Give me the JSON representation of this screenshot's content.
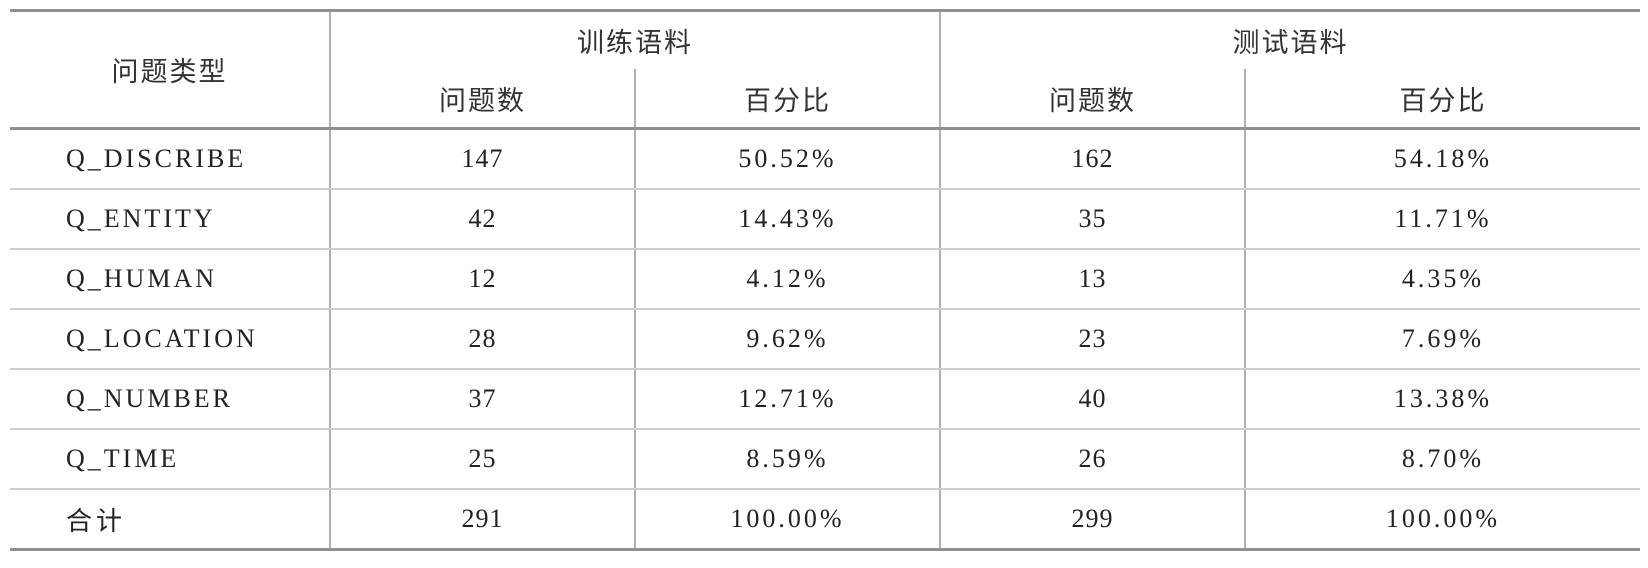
{
  "table": {
    "type_header": "问题类型",
    "groups": [
      {
        "label": "训练语料",
        "count_label": "问题数",
        "pct_label": "百分比"
      },
      {
        "label": "测试语料",
        "count_label": "问题数",
        "pct_label": "百分比"
      }
    ],
    "rows": [
      {
        "type": "Q_DISCRIBE",
        "train_count": "147",
        "train_pct": "50.52%",
        "test_count": "162",
        "test_pct": "54.18%"
      },
      {
        "type": "Q_ENTITY",
        "train_count": "42",
        "train_pct": "14.43%",
        "test_count": "35",
        "test_pct": "11.71%"
      },
      {
        "type": "Q_HUMAN",
        "train_count": "12",
        "train_pct": "4.12%",
        "test_count": "13",
        "test_pct": "4.35%"
      },
      {
        "type": "Q_LOCATION",
        "train_count": "28",
        "train_pct": "9.62%",
        "test_count": "23",
        "test_pct": "7.69%"
      },
      {
        "type": "Q_NUMBER",
        "train_count": "37",
        "train_pct": "12.71%",
        "test_count": "40",
        "test_pct": "13.38%"
      },
      {
        "type": "Q_TIME",
        "train_count": "25",
        "train_pct": "8.59%",
        "test_count": "26",
        "test_pct": "8.70%"
      }
    ],
    "total": {
      "type": "合计",
      "train_count": "291",
      "train_pct": "100.00%",
      "test_count": "299",
      "test_pct": "100.00%"
    }
  }
}
